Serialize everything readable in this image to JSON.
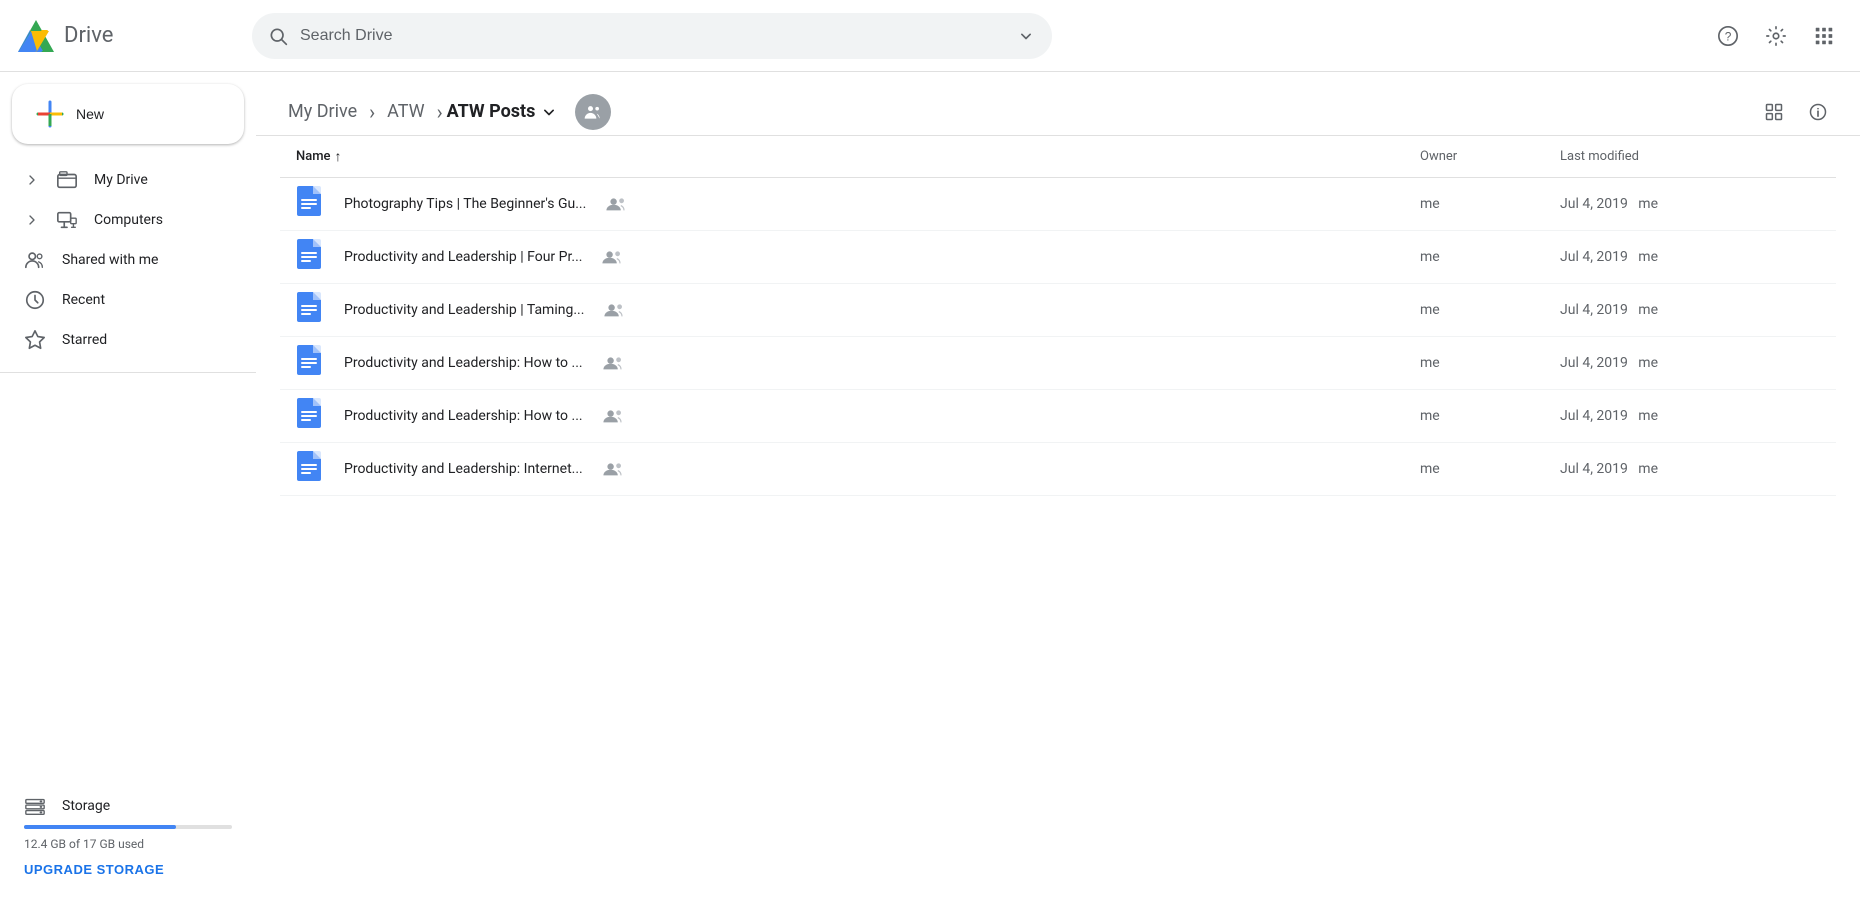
{
  "app": {
    "name": "Drive"
  },
  "header": {
    "search_placeholder": "Search Drive",
    "help_icon": "?",
    "settings_icon": "⚙",
    "apps_icon": "⠿"
  },
  "sidebar": {
    "new_button_label": "New",
    "items": [
      {
        "id": "my-drive",
        "label": "My Drive",
        "icon": "📄",
        "expandable": true
      },
      {
        "id": "computers",
        "label": "Computers",
        "icon": "🖥",
        "expandable": true
      },
      {
        "id": "shared-with-me",
        "label": "Shared with me",
        "icon": "👥"
      },
      {
        "id": "recent",
        "label": "Recent",
        "icon": "🕐"
      },
      {
        "id": "starred",
        "label": "Starred",
        "icon": "☆"
      }
    ],
    "storage": {
      "label": "Storage",
      "used_text": "12.4 GB of 17 GB used",
      "used_percent": 72,
      "upgrade_label": "UPGRADE STORAGE"
    }
  },
  "breadcrumb": {
    "items": [
      {
        "label": "My Drive"
      },
      {
        "label": "ATW"
      },
      {
        "label": "ATW Posts"
      }
    ],
    "separator": "›"
  },
  "table": {
    "columns": {
      "name": "Name",
      "owner": "Owner",
      "last_modified": "Last modified"
    },
    "files": [
      {
        "name": "Photography Tips | The Beginner's Gu...",
        "owner": "me",
        "modified": "Jul 4, 2019",
        "modified_by": "me"
      },
      {
        "name": "Productivity and Leadership | Four Pr...",
        "owner": "me",
        "modified": "Jul 4, 2019",
        "modified_by": "me"
      },
      {
        "name": "Productivity and Leadership | Taming...",
        "owner": "me",
        "modified": "Jul 4, 2019",
        "modified_by": "me"
      },
      {
        "name": "Productivity and Leadership: How to ...",
        "owner": "me",
        "modified": "Jul 4, 2019",
        "modified_by": "me"
      },
      {
        "name": "Productivity and Leadership: How to ...",
        "owner": "me",
        "modified": "Jul 4, 2019",
        "modified_by": "me"
      },
      {
        "name": "Productivity and Leadership: Internet...",
        "owner": "me",
        "modified": "Jul 4, 2019",
        "modified_by": "me"
      }
    ]
  },
  "colors": {
    "blue": "#4285f4",
    "green": "#34a853",
    "yellow": "#fbbc04",
    "red": "#ea4335",
    "storage_bar": "#4285f4",
    "upgrade_text": "#1a73e8"
  }
}
